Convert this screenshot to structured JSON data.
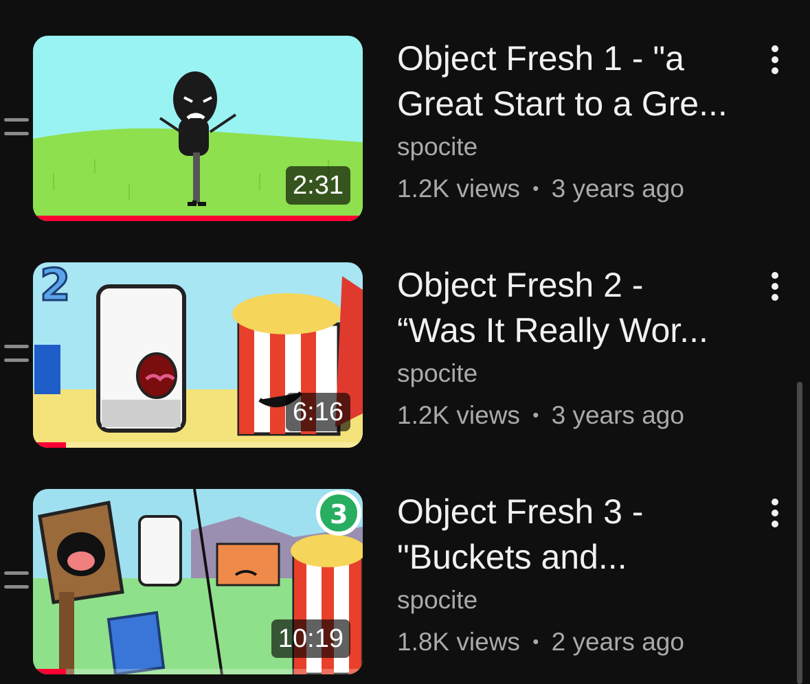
{
  "videos": [
    {
      "title": "Object Fresh 1 - \"a\nGreat Start to a Gre...",
      "channel": "spocite",
      "views": "1.2K views",
      "separator": "•",
      "age": "3 years ago",
      "duration": "2:31",
      "watched_fraction": 1.0
    },
    {
      "title": "Object Fresh 2 -\n“Was It Really Wor...",
      "channel": "spocite",
      "views": "1.2K views",
      "separator": "•",
      "age": "3 years ago",
      "duration": "6:16",
      "watched_fraction": 0.1
    },
    {
      "title": "Object Fresh 3 -\n\"Buckets and...",
      "channel": "spocite",
      "views": "1.8K views",
      "separator": "•",
      "age": "2 years ago",
      "duration": "10:19",
      "watched_fraction": 0.1
    }
  ],
  "icons": {
    "drag": "drag-handle-icon",
    "menu": "more-vert-icon"
  },
  "colors": {
    "background": "#0f0f0f",
    "progress": "#ff0033",
    "secondary_text": "#aaaaaa"
  }
}
